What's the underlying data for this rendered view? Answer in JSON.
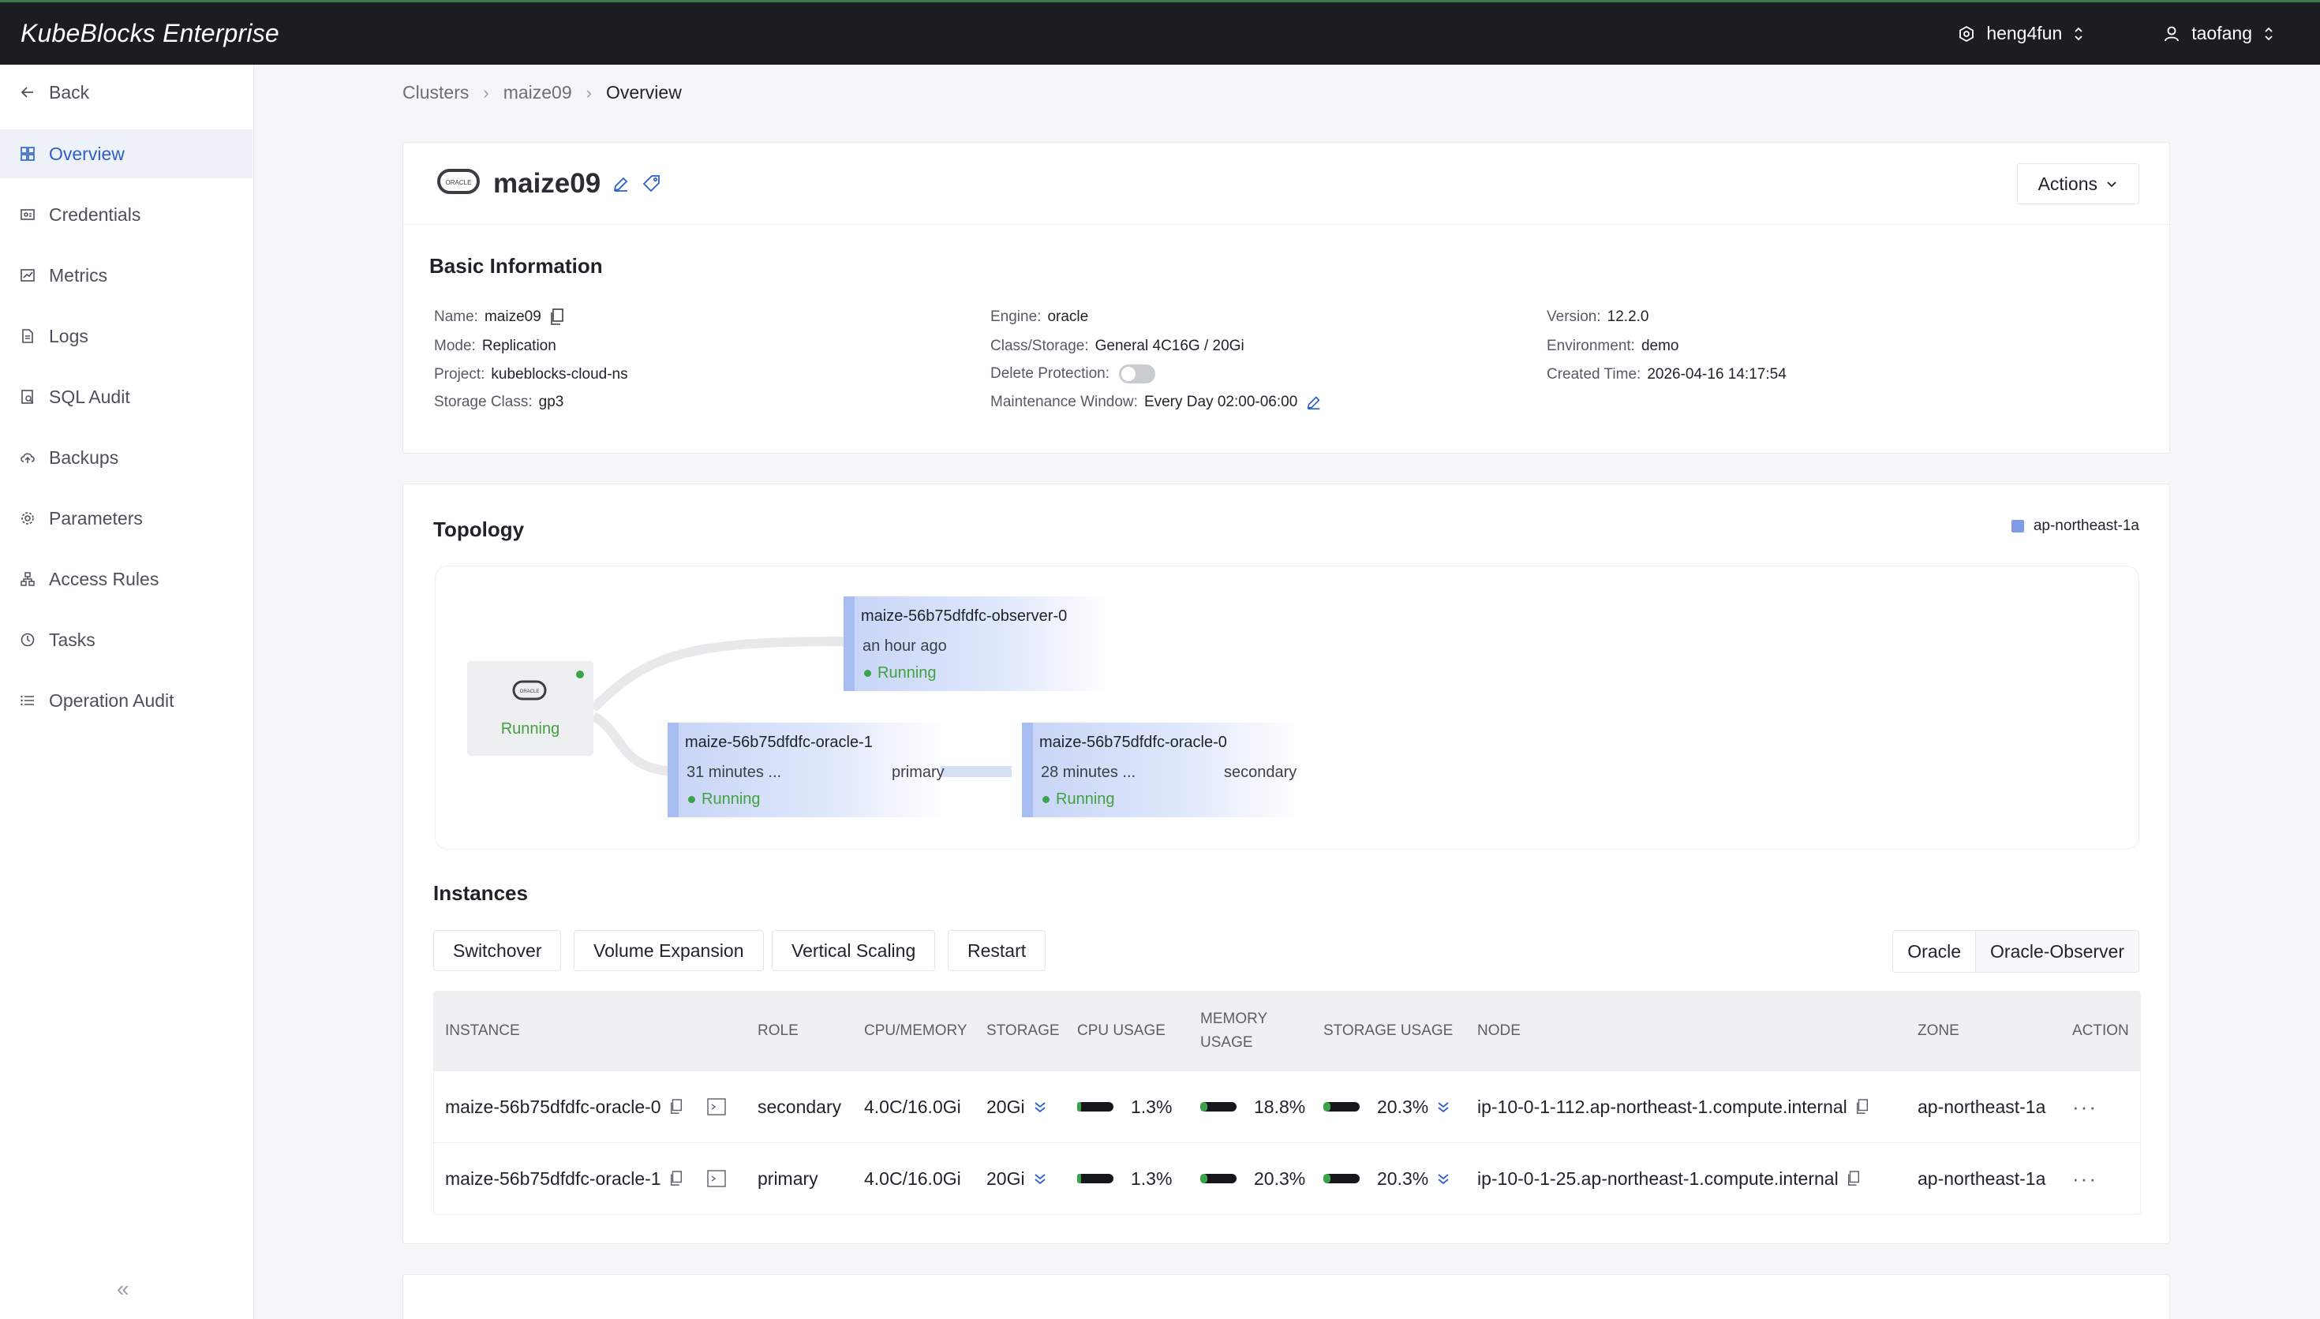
{
  "topbar": {
    "brand": "KubeBlocks Enterprise",
    "org": "heng4fun",
    "user": "taofang"
  },
  "sidebar": {
    "back": "Back",
    "items": [
      {
        "label": "Overview",
        "icon": "grid-icon",
        "active": true
      },
      {
        "label": "Credentials",
        "icon": "credential-icon"
      },
      {
        "label": "Metrics",
        "icon": "chart-icon"
      },
      {
        "label": "Logs",
        "icon": "file-icon"
      },
      {
        "label": "SQL Audit",
        "icon": "sql-audit-icon"
      },
      {
        "label": "Backups",
        "icon": "cloud-icon"
      },
      {
        "label": "Parameters",
        "icon": "gear-icon"
      },
      {
        "label": "Access Rules",
        "icon": "network-icon"
      },
      {
        "label": "Tasks",
        "icon": "clock-icon"
      },
      {
        "label": "Operation Audit",
        "icon": "list-icon"
      }
    ]
  },
  "breadcrumb": {
    "items": [
      "Clusters",
      "maize09",
      "Overview"
    ]
  },
  "cluster": {
    "name": "maize09",
    "actions_label": "Actions"
  },
  "basic_info": {
    "title": "Basic Information",
    "name": {
      "key": "Name:",
      "value": "maize09"
    },
    "mode": {
      "key": "Mode:",
      "value": "Replication"
    },
    "project": {
      "key": "Project:",
      "value": "kubeblocks-cloud-ns"
    },
    "storage_class": {
      "key": "Storage Class:",
      "value": "gp3"
    },
    "engine": {
      "key": "Engine:",
      "value": "oracle"
    },
    "class_storage": {
      "key": "Class/Storage:",
      "value": "General 4C16G / 20Gi"
    },
    "delete_protection": {
      "key": "Delete Protection:",
      "enabled": false
    },
    "maintenance": {
      "key": "Maintenance Window:",
      "value": "Every Day 02:00-06:00"
    },
    "version": {
      "key": "Version:",
      "value": "12.2.0"
    },
    "environment": {
      "key": "Environment:",
      "value": "demo"
    },
    "created": {
      "key": "Created Time:",
      "value": "2026-04-16 14:17:54"
    }
  },
  "topology": {
    "title": "Topology",
    "zone": "ap-northeast-1a",
    "root_status": "Running",
    "pods": {
      "observer": {
        "name": "maize-56b75dfdfc-observer-0",
        "time": "an hour ago",
        "status": "Running"
      },
      "oracle1": {
        "name": "maize-56b75dfdfc-oracle-1",
        "time": "31 minutes ...",
        "role": "primary",
        "status": "Running"
      },
      "oracle0": {
        "name": "maize-56b75dfdfc-oracle-0",
        "time": "28 minutes ...",
        "role": "secondary",
        "status": "Running"
      }
    }
  },
  "instances": {
    "title": "Instances",
    "buttons": [
      "Switchover",
      "Volume Expansion",
      "Vertical Scaling",
      "Restart"
    ],
    "tabs": [
      "Oracle",
      "Oracle-Observer"
    ],
    "columns": [
      "INSTANCE",
      "ROLE",
      "CPU/MEMORY",
      "STORAGE",
      "CPU USAGE",
      "MEMORY USAGE",
      "STORAGE USAGE",
      "NODE",
      "ZONE",
      "ACTION"
    ],
    "rows": [
      {
        "instance": "maize-56b75dfdfc-oracle-0",
        "role": "secondary",
        "cpu_memory": "4.0C/16.0Gi",
        "storage": "20Gi",
        "cpu_usage": "1.3%",
        "cpu_frac": 0.013,
        "memory_usage": "18.8%",
        "memory_frac": 0.188,
        "storage_usage": "20.3%",
        "storage_frac": 0.203,
        "node": "ip-10-0-1-112.ap-northeast-1.compute.internal",
        "zone": "ap-northeast-1a",
        "action": "···"
      },
      {
        "instance": "maize-56b75dfdfc-oracle-1",
        "role": "primary",
        "cpu_memory": "4.0C/16.0Gi",
        "storage": "20Gi",
        "cpu_usage": "1.3%",
        "cpu_frac": 0.013,
        "memory_usage": "20.3%",
        "memory_frac": 0.203,
        "storage_usage": "20.3%",
        "storage_frac": 0.203,
        "node": "ip-10-0-1-25.ap-northeast-1.compute.internal",
        "zone": "ap-northeast-1a",
        "action": "···"
      }
    ]
  },
  "colors": {
    "accent": "#2b5fcb",
    "running": "#44a140",
    "topbar": "#1b1d22"
  }
}
